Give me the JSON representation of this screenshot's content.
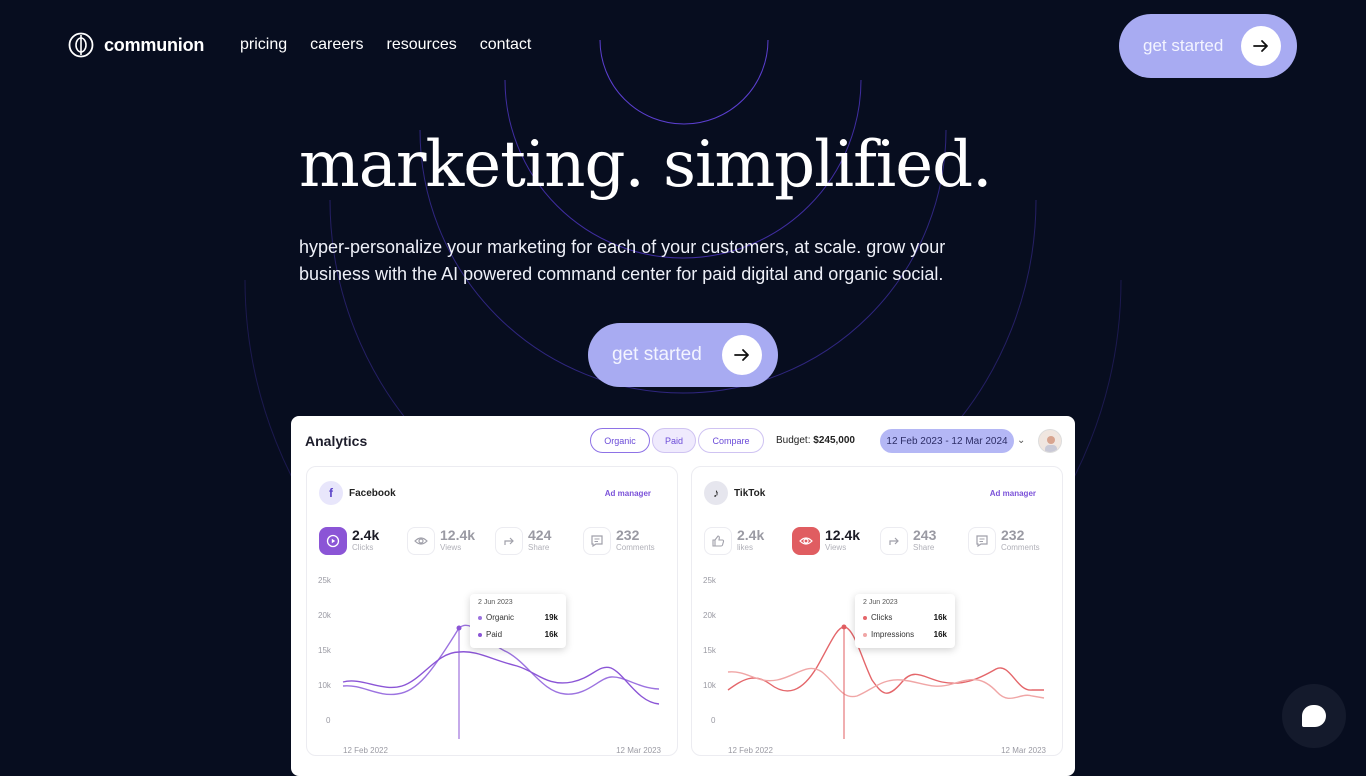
{
  "brand": {
    "name": "communion",
    "accent": "#a8abf2",
    "background": "#070d1f"
  },
  "nav": [
    "pricing",
    "careers",
    "resources",
    "contact"
  ],
  "header_cta": {
    "label": "get started"
  },
  "hero": {
    "headline": "marketing. simplified.",
    "subhead": "hyper-personalize your marketing for each of your customers, at scale. grow your business with the AI powered command center for paid digital and organic social.",
    "cta": "get started"
  },
  "dashboard": {
    "title": "Analytics",
    "segments": [
      "Organic",
      "Paid",
      "Compare"
    ],
    "budget_label": "Budget:",
    "budget_value": "$245,000",
    "date_range": "12 Feb 2023 - 12 Mar 2024",
    "facebook": {
      "name": "Facebook",
      "ad_manager": "Ad manager",
      "metrics": [
        {
          "value": "2.4k",
          "label": "Clicks",
          "icon": "play-icon"
        },
        {
          "value": "12.4k",
          "label": "Views",
          "icon": "eye-icon"
        },
        {
          "value": "424",
          "label": "Share",
          "icon": "share-icon"
        },
        {
          "value": "232",
          "label": "Comments",
          "icon": "comment-icon"
        }
      ],
      "y_ticks": [
        "25k",
        "20k",
        "15k",
        "10k",
        "0"
      ],
      "x_start": "12 Feb 2022",
      "x_end": "12 Mar 2023",
      "tooltip": {
        "date": "2 Jun 2023",
        "rows": [
          {
            "label": "Organic",
            "value": "19k"
          },
          {
            "label": "Paid",
            "value": "16k"
          }
        ]
      }
    },
    "tiktok": {
      "name": "TikTok",
      "ad_manager": "Ad manager",
      "metrics": [
        {
          "value": "2.4k",
          "label": "likes",
          "icon": "thumbs-up-icon"
        },
        {
          "value": "12.4k",
          "label": "Views",
          "icon": "eye-icon"
        },
        {
          "value": "243",
          "label": "Share",
          "icon": "share-icon"
        },
        {
          "value": "232",
          "label": "Comments",
          "icon": "comment-icon"
        }
      ],
      "y_ticks": [
        "25k",
        "20k",
        "15k",
        "10k",
        "0"
      ],
      "x_start": "12 Feb 2022",
      "x_end": "12 Mar 2023",
      "tooltip": {
        "date": "2 Jun 2023",
        "rows": [
          {
            "label": "Clicks",
            "value": "16k"
          },
          {
            "label": "Impressions",
            "value": "16k"
          }
        ]
      }
    }
  }
}
